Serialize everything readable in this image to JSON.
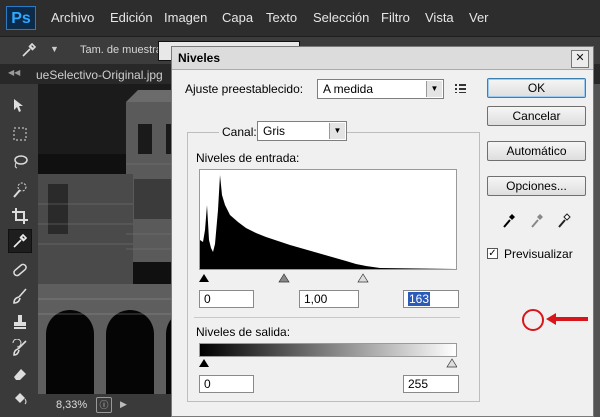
{
  "app": {
    "logo": "Ps"
  },
  "menubar": {
    "items": [
      "Archivo",
      "Edición",
      "Imagen",
      "Capa",
      "Texto",
      "Selección",
      "Filtro",
      "Vista",
      "Ver"
    ]
  },
  "options_bar": {
    "sample_label": "Tam. de muestra:"
  },
  "tab_bar": {
    "document": "ueSelectivo-Original.jpg",
    "collapse_icon": "double-chevron-left"
  },
  "status_bar": {
    "zoom": "8,33%"
  },
  "dialog": {
    "title": "Niveles",
    "preset_label": "Ajuste preestablecido:",
    "preset_value": "A medida",
    "channel_label": "Canal:",
    "channel_value": "Gris",
    "input_levels_label": "Niveles de entrada:",
    "input_black": "0",
    "input_gamma": "1,00",
    "input_white": "163",
    "output_levels_label": "Niveles de salida:",
    "output_black": "0",
    "output_white": "255",
    "buttons": {
      "ok": "OK",
      "cancel": "Cancelar",
      "auto": "Automático",
      "options": "Opciones..."
    },
    "preview_label": "Previsualizar",
    "preview_checked": true,
    "highlight_color": "#d9151c"
  }
}
